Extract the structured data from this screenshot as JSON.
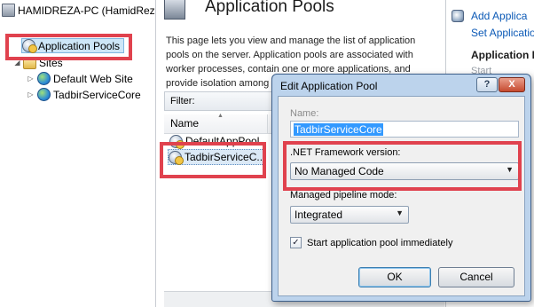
{
  "tree": {
    "server": "HAMIDREZA-PC (HamidRez",
    "app_pools": "Application Pools",
    "sites": "Sites",
    "site1": "Default Web Site",
    "site2": "TadbirServiceCore"
  },
  "center": {
    "title": "Application Pools",
    "description": "This page lets you view and manage the list of application pools on the server. Application pools are associated with worker processes, contain one or more applications, and provide isolation among",
    "filter_label": "Filter:",
    "col_name": "Name",
    "col_partial": "S",
    "rows": [
      "DefaultAppPool",
      "TadbirServiceC..."
    ]
  },
  "actions": {
    "add": "Add Applica",
    "set": "Set Applicatio",
    "heading": "Application Po",
    "start": "Start"
  },
  "dialog": {
    "title": "Edit Application Pool",
    "help": "?",
    "close": "X",
    "name_label": "Name:",
    "name_value": "TadbirServiceCore",
    "framework_label": ".NET Framework version:",
    "framework_value": "No Managed Code",
    "pipeline_label": "Managed pipeline mode:",
    "pipeline_value": "Integrated",
    "start_label": "Start application pool immediately",
    "start_checked": true,
    "ok": "OK",
    "cancel": "Cancel"
  },
  "colors": {
    "annotation_red": "#e0424e",
    "selection_blue": "#3399ff",
    "link_blue": "#0b59b6"
  }
}
